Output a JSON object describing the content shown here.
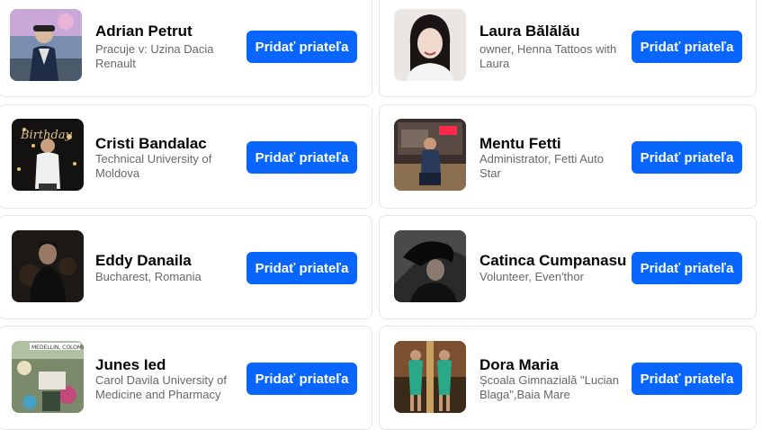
{
  "accent_color": "#0866ff",
  "suggestions": [
    {
      "name": "Adrian Petrut",
      "subtitle": "Pracuje v: Uzina Dacia Renault",
      "button_label": "Pridať priateľa",
      "avatar": "avatar-photo"
    },
    {
      "name": "Laura Bălălău",
      "subtitle": "owner, Henna Tattoos with Laura",
      "button_label": "Pridať priateľa",
      "avatar": "avatar-photo"
    },
    {
      "name": "Cristi Bandalac",
      "subtitle": "Technical University of Moldova",
      "button_label": "Pridať priateľa",
      "avatar": "avatar-photo"
    },
    {
      "name": "Mentu Fetti",
      "subtitle": "Administrator, Fetti Auto Star",
      "button_label": "Pridať priateľa",
      "avatar": "avatar-photo"
    },
    {
      "name": "Eddy Danaila",
      "subtitle": "Bucharest, Romania",
      "button_label": "Pridať priateľa",
      "avatar": "avatar-photo"
    },
    {
      "name": "Catinca Cumpanasu",
      "subtitle": "Volunteer, Even'thor",
      "button_label": "Pridať priateľa",
      "avatar": "avatar-photo"
    },
    {
      "name": "Junes Ied",
      "subtitle": "Carol Davila University of Medicine and Pharmacy",
      "button_label": "Pridať priateľa",
      "avatar": "avatar-photo"
    },
    {
      "name": "Dora Maria",
      "subtitle": "Școala Gimnazială \"Lucian Blaga\",Baia Mare",
      "button_label": "Pridať priateľa",
      "avatar": "avatar-photo"
    }
  ]
}
